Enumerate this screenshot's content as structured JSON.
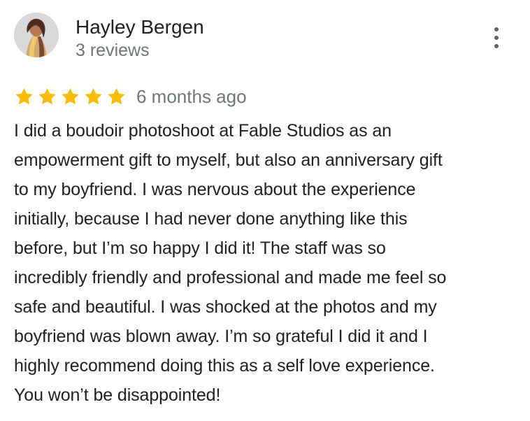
{
  "review": {
    "reviewer": {
      "name": "Hayley Bergen",
      "review_count": "3 reviews",
      "avatar_icon": "user-photo-icon"
    },
    "menu_icon": "more-vertical-icon",
    "rating": {
      "stars": 5,
      "max_stars": 5,
      "star_color": "#fbbc04",
      "time_ago": "6 months ago"
    },
    "text_lines": [
      "I did a boudoir photoshoot at Fable Studios as an",
      "empowerment gift to myself, but also an anniversary gift",
      "to my boyfriend. I was nervous about the experience",
      "initially, because I had never done anything like this",
      "before, but I’m so happy I did it! The staff was so",
      "incredibly friendly and professional and made me feel so",
      "safe and beautiful. I was shocked at the photos and my",
      "boyfriend was blown away. I’m so grateful I did it and I",
      "highly recommend doing this as a self love experience.",
      "You won’t be disappointed!"
    ]
  },
  "colors": {
    "primary_text": "#202124",
    "secondary_text": "#70757a",
    "icon": "#5f6368",
    "background": "#ffffff"
  }
}
